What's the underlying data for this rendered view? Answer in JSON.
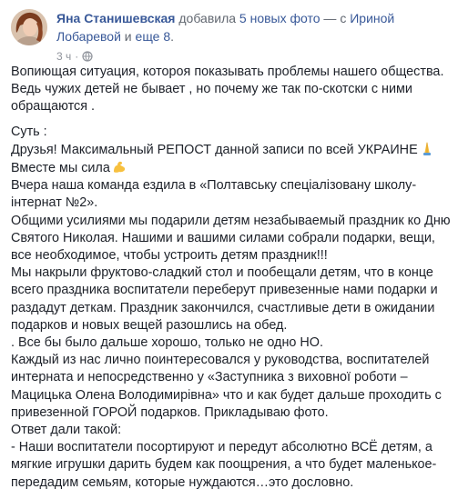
{
  "header": {
    "author": "Яна Станишевская",
    "action": " добавила ",
    "photos_link": "5 новых фото",
    "with_prefix": " — с ",
    "tagged_first": "Ириной Лобаревой",
    "and_text": " и ",
    "others_link": "еще 8",
    "end_punct": ".",
    "time": "3 ч",
    "separator": "·",
    "avatar_icon": "user-avatar",
    "privacy_icon": "globe-icon"
  },
  "post": {
    "p1": [
      "Вопиющая ситуация, котороя показывать проблемы нашего общества.",
      "Ведь чужих детей не бывает , но почему же так по-скотски с ними",
      "обращаются ."
    ],
    "p2": [
      "Суть :",
      "Друзья! Максимальный РЕПОСТ данной записи по всей УКРАИНЕ",
      "Вместе мы сила",
      "Вчера наша команда ездила в «Полтавську спеціалізовану школу-",
      "інтернат №2».",
      "Общими усилиями мы подарили детям незабываемый праздник ко Дню",
      "Святого Николая. Нашими и вашими силами собрали подарки, вещи,",
      "все необходимое, чтобы устроить детям праздник!!!",
      "Мы накрыли фруктово-сладкий стол и пообещали детям, что в конце",
      "всего праздника воспитатели переберут привезенные нами подарки и",
      "раздадут деткам. Праздник закончился, счастливые дети в ожидании",
      "подарков и новых вещей разошлись на обед.",
      ". Все бы было дальше хорошо, только не одно НО.",
      "Каждый из нас лично поинтересовался у руководства, воспитателей",
      "интерната и непосредственно у «Заступника з виховної роботи –",
      "Мацицька Олена Володимирівна» что и как будет дальше проходить с",
      "привезенной ГОРОЙ подарков. Прикладываю фото.",
      "Ответ дали такой:",
      "- Наши воспитатели посортируют и передут абсолютно ВСЁ детям, а",
      "мягкие игрушки дарить будем как поощрения, а что будет маленькое-",
      "передадим семьям, которые нуждаются…это дословно."
    ],
    "emoji_pray": "folded-hands-emoji",
    "emoji_muscle": "flexed-biceps-emoji"
  }
}
